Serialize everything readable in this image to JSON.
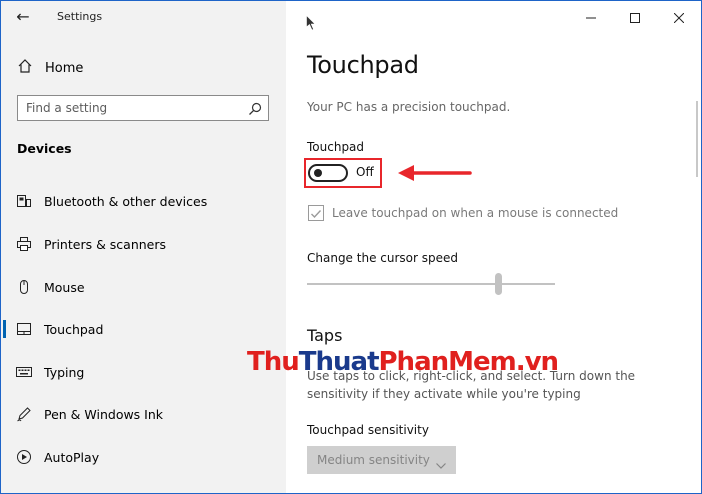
{
  "window": {
    "title": "Settings",
    "back_glyph": "←",
    "controls": [
      "minimize-icon",
      "maximize-icon",
      "close-icon"
    ]
  },
  "sidebar": {
    "home_label": "Home",
    "search_placeholder": "Find a setting",
    "section_title": "Devices",
    "items": [
      {
        "label": "Bluetooth & other devices",
        "icon": "bluetooth-devices-icon"
      },
      {
        "label": "Printers & scanners",
        "icon": "printer-icon"
      },
      {
        "label": "Mouse",
        "icon": "mouse-icon"
      },
      {
        "label": "Touchpad",
        "icon": "touchpad-icon",
        "selected": true
      },
      {
        "label": "Typing",
        "icon": "keyboard-icon"
      },
      {
        "label": "Pen & Windows Ink",
        "icon": "pen-icon"
      },
      {
        "label": "AutoPlay",
        "icon": "autoplay-icon"
      }
    ]
  },
  "main": {
    "page_title": "Touchpad",
    "description": "Your PC has a precision touchpad.",
    "touchpad_label": "Touchpad",
    "toggle_state": "Off",
    "toggle_on": false,
    "checkbox_label": "Leave touchpad on when a mouse is connected",
    "checkbox_checked": true,
    "cursor_speed_label": "Change the cursor speed",
    "cursor_speed_fraction": 0.77,
    "taps_title": "Taps",
    "taps_description": "Use taps to click, right-click, and select. Turn down the sensitivity if they activate while you're typing",
    "sensitivity_label": "Touchpad sensitivity",
    "sensitivity_value": "Medium sensitivity"
  },
  "watermark": {
    "part1": "Thu",
    "part2": "Thuat",
    "part3": "PhanMem.vn"
  },
  "colors": {
    "accent": "#0063b1",
    "highlight": "#e8262b",
    "sidebar_bg": "#f2f2f2",
    "border": "#1e64c8"
  }
}
